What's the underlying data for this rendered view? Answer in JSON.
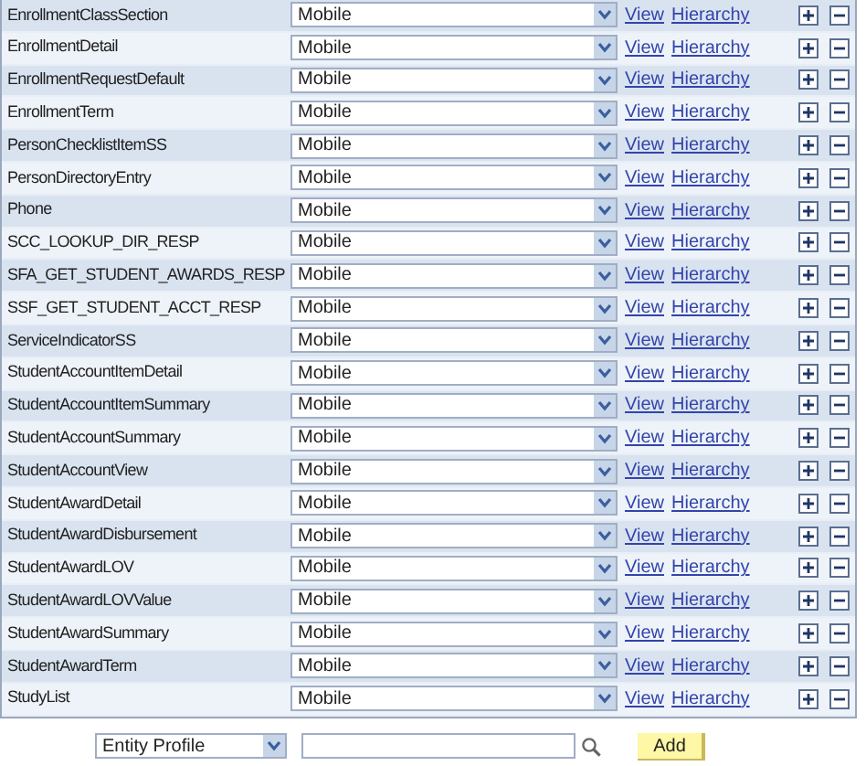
{
  "rows": [
    {
      "name": "EnrollmentClassSection",
      "profile": "Mobile",
      "view": "View",
      "hierarchy": "Hierarchy"
    },
    {
      "name": "EnrollmentDetail",
      "profile": "Mobile",
      "view": "View",
      "hierarchy": "Hierarchy"
    },
    {
      "name": "EnrollmentRequestDefault",
      "profile": "Mobile",
      "view": "View",
      "hierarchy": "Hierarchy"
    },
    {
      "name": "EnrollmentTerm",
      "profile": "Mobile",
      "view": "View",
      "hierarchy": "Hierarchy"
    },
    {
      "name": "PersonChecklistItemSS",
      "profile": "Mobile",
      "view": "View",
      "hierarchy": "Hierarchy"
    },
    {
      "name": "PersonDirectoryEntry",
      "profile": "Mobile",
      "view": "View",
      "hierarchy": "Hierarchy"
    },
    {
      "name": "Phone",
      "profile": "Mobile",
      "view": "View",
      "hierarchy": "Hierarchy"
    },
    {
      "name": "SCC_LOOKUP_DIR_RESP",
      "profile": "Mobile",
      "view": "View",
      "hierarchy": "Hierarchy"
    },
    {
      "name": "SFA_GET_STUDENT_AWARDS_RESP",
      "profile": "Mobile",
      "view": "View",
      "hierarchy": "Hierarchy"
    },
    {
      "name": "SSF_GET_STUDENT_ACCT_RESP",
      "profile": "Mobile",
      "view": "View",
      "hierarchy": "Hierarchy"
    },
    {
      "name": "ServiceIndicatorSS",
      "profile": "Mobile",
      "view": "View",
      "hierarchy": "Hierarchy"
    },
    {
      "name": "StudentAccountItemDetail",
      "profile": "Mobile",
      "view": "View",
      "hierarchy": "Hierarchy"
    },
    {
      "name": "StudentAccountItemSummary",
      "profile": "Mobile",
      "view": "View",
      "hierarchy": "Hierarchy"
    },
    {
      "name": "StudentAccountSummary",
      "profile": "Mobile",
      "view": "View",
      "hierarchy": "Hierarchy"
    },
    {
      "name": "StudentAccountView",
      "profile": "Mobile",
      "view": "View",
      "hierarchy": "Hierarchy"
    },
    {
      "name": "StudentAwardDetail",
      "profile": "Mobile",
      "view": "View",
      "hierarchy": "Hierarchy"
    },
    {
      "name": "StudentAwardDisbursement",
      "profile": "Mobile",
      "view": "View",
      "hierarchy": "Hierarchy"
    },
    {
      "name": "StudentAwardLOV",
      "profile": "Mobile",
      "view": "View",
      "hierarchy": "Hierarchy"
    },
    {
      "name": "StudentAwardLOVValue",
      "profile": "Mobile",
      "view": "View",
      "hierarchy": "Hierarchy"
    },
    {
      "name": "StudentAwardSummary",
      "profile": "Mobile",
      "view": "View",
      "hierarchy": "Hierarchy"
    },
    {
      "name": "StudentAwardTerm",
      "profile": "Mobile",
      "view": "View",
      "hierarchy": "Hierarchy"
    },
    {
      "name": "StudyList",
      "profile": "Mobile",
      "view": "View",
      "hierarchy": "Hierarchy"
    }
  ],
  "footer": {
    "type_select": "Entity Profile",
    "add_button": "Add"
  }
}
